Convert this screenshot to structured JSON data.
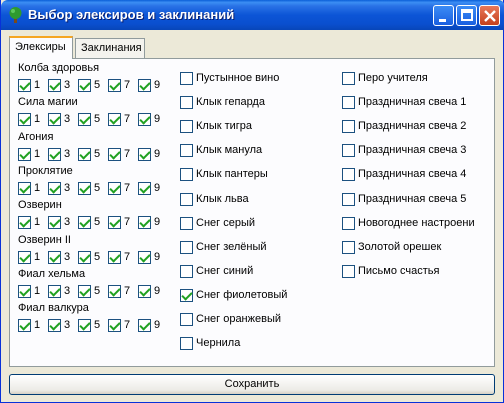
{
  "window": {
    "title": "Выбор элексиров и заклинаний"
  },
  "tabs": [
    {
      "label": "Элексиры",
      "active": true
    },
    {
      "label": "Заклинания",
      "active": false
    }
  ],
  "levels": [
    "1",
    "3",
    "5",
    "7",
    "9"
  ],
  "elixirs": [
    {
      "name": "Колба здоровья",
      "checked": [
        true,
        true,
        true,
        true,
        true
      ]
    },
    {
      "name": "Сила магии",
      "checked": [
        true,
        true,
        true,
        true,
        true
      ]
    },
    {
      "name": "Агония",
      "checked": [
        true,
        true,
        true,
        true,
        true
      ]
    },
    {
      "name": "Проклятие",
      "checked": [
        true,
        true,
        true,
        true,
        true
      ]
    },
    {
      "name": "Озверин",
      "checked": [
        true,
        true,
        true,
        true,
        true
      ]
    },
    {
      "name": "Озверин II",
      "checked": [
        true,
        true,
        true,
        true,
        true
      ]
    },
    {
      "name": "Фиал хельма",
      "checked": [
        true,
        true,
        true,
        true,
        true
      ]
    },
    {
      "name": "Фиал валкура",
      "checked": [
        true,
        true,
        true,
        true,
        true
      ]
    }
  ],
  "items_col2": [
    {
      "label": "Пустынное вино",
      "checked": false
    },
    {
      "label": "Клык гепарда",
      "checked": false
    },
    {
      "label": "Клык тигра",
      "checked": false
    },
    {
      "label": "Клык манула",
      "checked": false
    },
    {
      "label": "Клык пантеры",
      "checked": false
    },
    {
      "label": "Клык льва",
      "checked": false
    },
    {
      "label": "Снег серый",
      "checked": false
    },
    {
      "label": "Снег зелёный",
      "checked": false
    },
    {
      "label": "Снег синий",
      "checked": false
    },
    {
      "label": "Снег фиолетовый",
      "checked": true
    },
    {
      "label": "Снег оранжевый",
      "checked": false
    },
    {
      "label": "Чернила",
      "checked": false
    }
  ],
  "items_col3": [
    {
      "label": "Перо учителя",
      "checked": false
    },
    {
      "label": "Праздничная свеча 1",
      "checked": false
    },
    {
      "label": "Праздничная свеча 2",
      "checked": false
    },
    {
      "label": "Праздничная свеча 3",
      "checked": false
    },
    {
      "label": "Праздничная свеча 4",
      "checked": false
    },
    {
      "label": "Праздничная свеча 5",
      "checked": false
    },
    {
      "label": "Новогоднее настроени",
      "checked": false
    },
    {
      "label": "Золотой орешек",
      "checked": false
    },
    {
      "label": "Письмо счастья",
      "checked": false
    }
  ],
  "save_button": {
    "label": "Сохранить"
  },
  "icons": {
    "app": "tree-icon",
    "minimize": "minimize-icon",
    "maximize": "maximize-icon",
    "close": "close-icon"
  }
}
